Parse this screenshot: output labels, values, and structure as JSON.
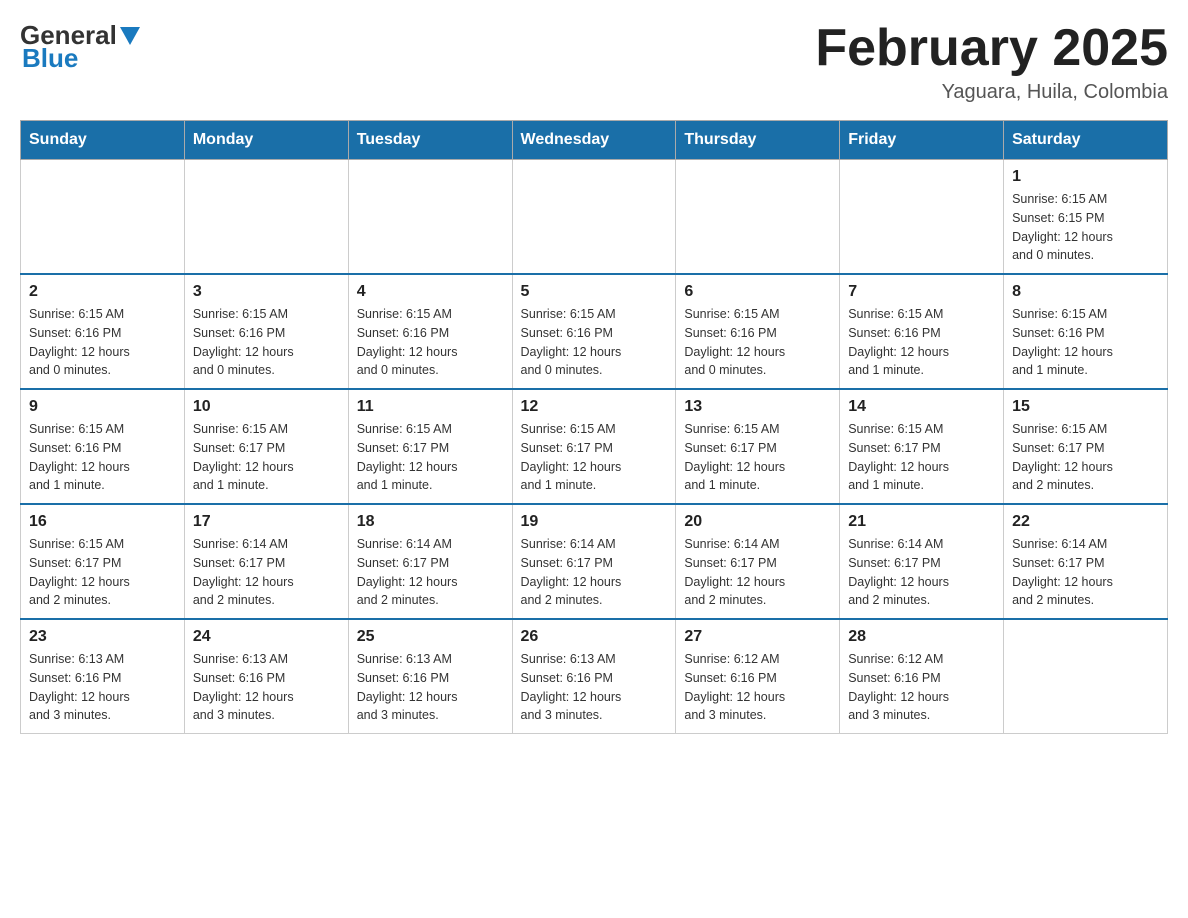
{
  "header": {
    "logo_general": "General",
    "logo_blue": "Blue",
    "month_title": "February 2025",
    "location": "Yaguara, Huila, Colombia"
  },
  "weekdays": [
    "Sunday",
    "Monday",
    "Tuesday",
    "Wednesday",
    "Thursday",
    "Friday",
    "Saturday"
  ],
  "weeks": [
    [
      {
        "day": "",
        "info": ""
      },
      {
        "day": "",
        "info": ""
      },
      {
        "day": "",
        "info": ""
      },
      {
        "day": "",
        "info": ""
      },
      {
        "day": "",
        "info": ""
      },
      {
        "day": "",
        "info": ""
      },
      {
        "day": "1",
        "info": "Sunrise: 6:15 AM\nSunset: 6:15 PM\nDaylight: 12 hours\nand 0 minutes."
      }
    ],
    [
      {
        "day": "2",
        "info": "Sunrise: 6:15 AM\nSunset: 6:16 PM\nDaylight: 12 hours\nand 0 minutes."
      },
      {
        "day": "3",
        "info": "Sunrise: 6:15 AM\nSunset: 6:16 PM\nDaylight: 12 hours\nand 0 minutes."
      },
      {
        "day": "4",
        "info": "Sunrise: 6:15 AM\nSunset: 6:16 PM\nDaylight: 12 hours\nand 0 minutes."
      },
      {
        "day": "5",
        "info": "Sunrise: 6:15 AM\nSunset: 6:16 PM\nDaylight: 12 hours\nand 0 minutes."
      },
      {
        "day": "6",
        "info": "Sunrise: 6:15 AM\nSunset: 6:16 PM\nDaylight: 12 hours\nand 0 minutes."
      },
      {
        "day": "7",
        "info": "Sunrise: 6:15 AM\nSunset: 6:16 PM\nDaylight: 12 hours\nand 1 minute."
      },
      {
        "day": "8",
        "info": "Sunrise: 6:15 AM\nSunset: 6:16 PM\nDaylight: 12 hours\nand 1 minute."
      }
    ],
    [
      {
        "day": "9",
        "info": "Sunrise: 6:15 AM\nSunset: 6:16 PM\nDaylight: 12 hours\nand 1 minute."
      },
      {
        "day": "10",
        "info": "Sunrise: 6:15 AM\nSunset: 6:17 PM\nDaylight: 12 hours\nand 1 minute."
      },
      {
        "day": "11",
        "info": "Sunrise: 6:15 AM\nSunset: 6:17 PM\nDaylight: 12 hours\nand 1 minute."
      },
      {
        "day": "12",
        "info": "Sunrise: 6:15 AM\nSunset: 6:17 PM\nDaylight: 12 hours\nand 1 minute."
      },
      {
        "day": "13",
        "info": "Sunrise: 6:15 AM\nSunset: 6:17 PM\nDaylight: 12 hours\nand 1 minute."
      },
      {
        "day": "14",
        "info": "Sunrise: 6:15 AM\nSunset: 6:17 PM\nDaylight: 12 hours\nand 1 minute."
      },
      {
        "day": "15",
        "info": "Sunrise: 6:15 AM\nSunset: 6:17 PM\nDaylight: 12 hours\nand 2 minutes."
      }
    ],
    [
      {
        "day": "16",
        "info": "Sunrise: 6:15 AM\nSunset: 6:17 PM\nDaylight: 12 hours\nand 2 minutes."
      },
      {
        "day": "17",
        "info": "Sunrise: 6:14 AM\nSunset: 6:17 PM\nDaylight: 12 hours\nand 2 minutes."
      },
      {
        "day": "18",
        "info": "Sunrise: 6:14 AM\nSunset: 6:17 PM\nDaylight: 12 hours\nand 2 minutes."
      },
      {
        "day": "19",
        "info": "Sunrise: 6:14 AM\nSunset: 6:17 PM\nDaylight: 12 hours\nand 2 minutes."
      },
      {
        "day": "20",
        "info": "Sunrise: 6:14 AM\nSunset: 6:17 PM\nDaylight: 12 hours\nand 2 minutes."
      },
      {
        "day": "21",
        "info": "Sunrise: 6:14 AM\nSunset: 6:17 PM\nDaylight: 12 hours\nand 2 minutes."
      },
      {
        "day": "22",
        "info": "Sunrise: 6:14 AM\nSunset: 6:17 PM\nDaylight: 12 hours\nand 2 minutes."
      }
    ],
    [
      {
        "day": "23",
        "info": "Sunrise: 6:13 AM\nSunset: 6:16 PM\nDaylight: 12 hours\nand 3 minutes."
      },
      {
        "day": "24",
        "info": "Sunrise: 6:13 AM\nSunset: 6:16 PM\nDaylight: 12 hours\nand 3 minutes."
      },
      {
        "day": "25",
        "info": "Sunrise: 6:13 AM\nSunset: 6:16 PM\nDaylight: 12 hours\nand 3 minutes."
      },
      {
        "day": "26",
        "info": "Sunrise: 6:13 AM\nSunset: 6:16 PM\nDaylight: 12 hours\nand 3 minutes."
      },
      {
        "day": "27",
        "info": "Sunrise: 6:12 AM\nSunset: 6:16 PM\nDaylight: 12 hours\nand 3 minutes."
      },
      {
        "day": "28",
        "info": "Sunrise: 6:12 AM\nSunset: 6:16 PM\nDaylight: 12 hours\nand 3 minutes."
      },
      {
        "day": "",
        "info": ""
      }
    ]
  ]
}
